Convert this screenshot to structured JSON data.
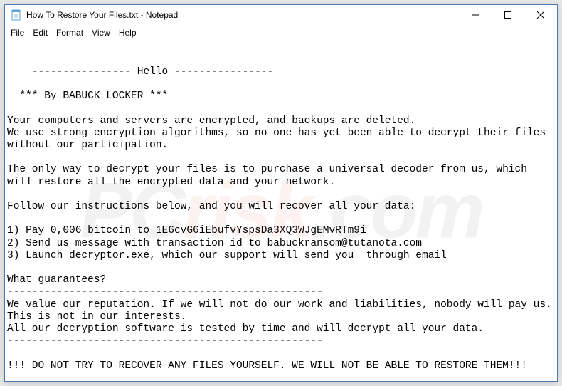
{
  "window": {
    "title": "How To Restore Your Files.txt - Notepad"
  },
  "menubar": {
    "items": [
      "File",
      "Edit",
      "Format",
      "View",
      "Help"
    ]
  },
  "editor": {
    "content": "---------------- Hello ----------------\n\n  *** By BABUCK LOCKER ***\n\nYour computers and servers are encrypted, and backups are deleted.\nWe use strong encryption algorithms, so no one has yet been able to decrypt their files without our participation.\n\nThe only way to decrypt your files is to purchase a universal decoder from us, which will restore all the encrypted data and your network.\n\nFollow our instructions below, and you will recover all your data:\n\n1) Pay 0,006 bitcoin to 1E6cvG6iEbufvYspsDa3XQ3WJgEMvRTm9i\n2) Send us message with transaction id to babuckransom@tutanota.com\n3) Launch decryptor.exe, which our support will send you  through email\n\nWhat guarantees?\n---------------------------------------------------\nWe value our reputation. If we will not do our work and liabilities, nobody will pay us. This is not in our interests.\nAll our decryption software is tested by time and will decrypt all your data.\n---------------------------------------------------\n\n!!! DO NOT TRY TO RECOVER ANY FILES YOURSELF. WE WILL NOT BE ABLE TO RESTORE THEM!!!"
  },
  "watermark": {
    "text_left": "PC",
    "text_right": ".com"
  }
}
